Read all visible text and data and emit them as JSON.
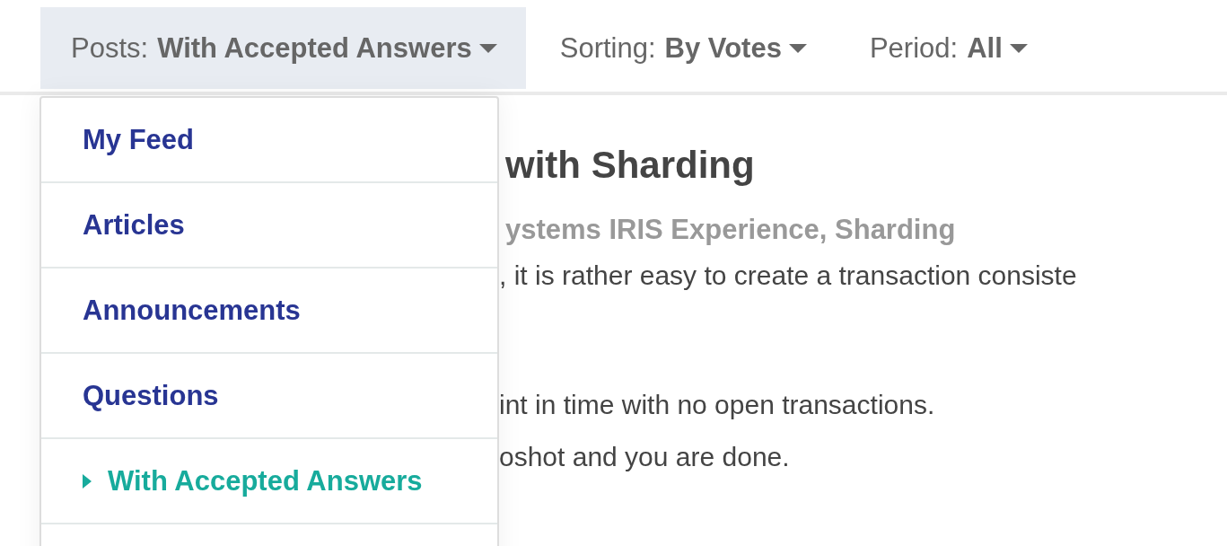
{
  "filters": [
    {
      "label": "Posts:",
      "value": "With Accepted Answers",
      "selected": true
    },
    {
      "label": "Sorting:",
      "value": "By Votes",
      "selected": false
    },
    {
      "label": "Period:",
      "value": "All",
      "selected": false
    }
  ],
  "post": {
    "title": "with Sharding",
    "tags": "ystems IRIS Experience, Sharding",
    "paragraphs": [
      [
        ", it is rather easy to create a transaction consiste"
      ],
      [
        "int in time with no open transactions.",
        "oshot and you are done."
      ]
    ]
  },
  "dropdown": {
    "items": [
      {
        "label": "My Feed",
        "selected": false
      },
      {
        "label": "Articles",
        "selected": false
      },
      {
        "label": "Announcements",
        "selected": false
      },
      {
        "label": "Questions",
        "selected": false
      },
      {
        "label": "With Accepted Answers",
        "selected": true
      }
    ]
  }
}
